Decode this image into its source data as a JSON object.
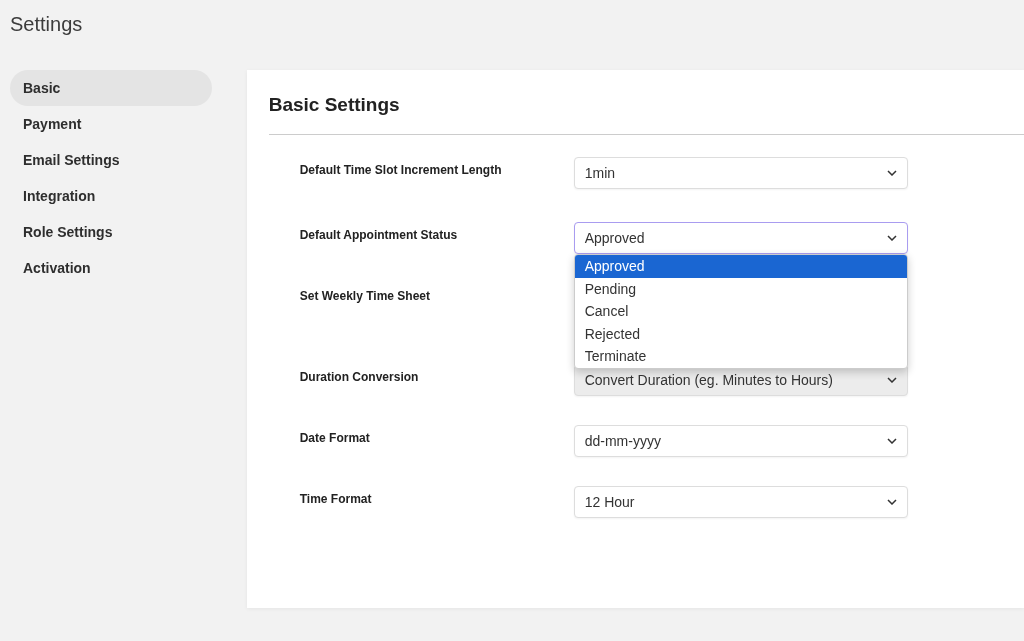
{
  "page_title": "Settings",
  "sidebar": {
    "items": [
      {
        "label": "Basic",
        "selected": true
      },
      {
        "label": "Payment",
        "selected": false
      },
      {
        "label": "Email Settings",
        "selected": false
      },
      {
        "label": "Integration",
        "selected": false
      },
      {
        "label": "Role Settings",
        "selected": false
      },
      {
        "label": "Activation",
        "selected": false
      }
    ]
  },
  "card": {
    "title": "Basic Settings",
    "fields": [
      {
        "kind": "select",
        "label": "Default Time Slot Increment Length",
        "value": "1min",
        "disabled": false,
        "open": false
      },
      {
        "kind": "select",
        "label": "Default Appointment Status",
        "value": "Approved",
        "disabled": false,
        "open": true,
        "options": [
          {
            "label": "Approved",
            "selected": true
          },
          {
            "label": "Pending",
            "selected": false
          },
          {
            "label": "Cancel",
            "selected": false
          },
          {
            "label": "Rejected",
            "selected": false
          },
          {
            "label": "Terminate",
            "selected": false
          }
        ]
      },
      {
        "kind": "hidden",
        "label": "Set Weekly Time Sheet"
      },
      {
        "kind": "select",
        "label": "Duration Conversion",
        "value": "Convert Duration (eg. Minutes to Hours)",
        "disabled": true,
        "open": false
      },
      {
        "kind": "select",
        "label": "Date Format",
        "value": "dd-mm-yyyy",
        "disabled": false,
        "open": false
      },
      {
        "kind": "select",
        "label": "Time Format",
        "value": "12 Hour",
        "disabled": false,
        "open": false
      }
    ]
  }
}
